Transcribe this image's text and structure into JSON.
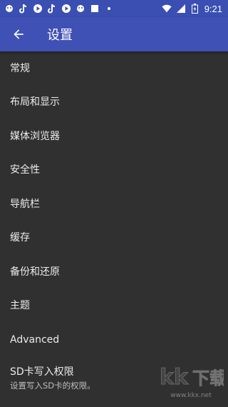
{
  "status_bar": {
    "time": "9:21",
    "icons": [
      "app-icon",
      "tiktok-icon",
      "play-icon",
      "tiktok-icon",
      "play-icon",
      "app-icon",
      "square-icon",
      "dot-icon",
      "wifi-icon",
      "signal-icon",
      "battery-icon"
    ]
  },
  "app_bar": {
    "title": "设置",
    "back_icon": "arrow-left-icon",
    "color": "#3f51b5"
  },
  "settings": {
    "items": [
      {
        "title": "常规"
      },
      {
        "title": "布局和显示"
      },
      {
        "title": "媒体浏览器"
      },
      {
        "title": "安全性"
      },
      {
        "title": "导航栏"
      },
      {
        "title": "缓存"
      },
      {
        "title": "备份和还原"
      },
      {
        "title": "主题"
      },
      {
        "title": "Advanced"
      },
      {
        "title": "SD卡写入权限",
        "subtitle": "设置写入SD卡的权限。"
      }
    ]
  },
  "watermark": {
    "text": "www.kkx.net"
  }
}
